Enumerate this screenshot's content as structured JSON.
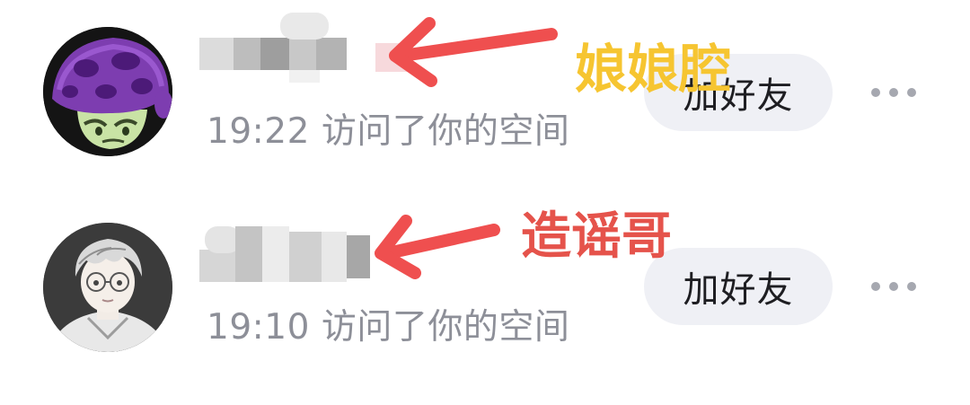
{
  "visitors": [
    {
      "avatar_icon": "mushroom-plant-avatar-icon",
      "time": "19:22",
      "action": "访问了你的空间",
      "add_label": "加好友",
      "more_icon": "more-dots-icon"
    },
    {
      "avatar_icon": "anime-boy-avatar-icon",
      "time": "19:10",
      "action": "访问了你的空间",
      "add_label": "加好友",
      "more_icon": "more-dots-icon"
    }
  ],
  "annotations": [
    {
      "text": "娘娘腔",
      "color": "#f6c531"
    },
    {
      "text": "造谣哥",
      "color": "#e5534b"
    }
  ]
}
